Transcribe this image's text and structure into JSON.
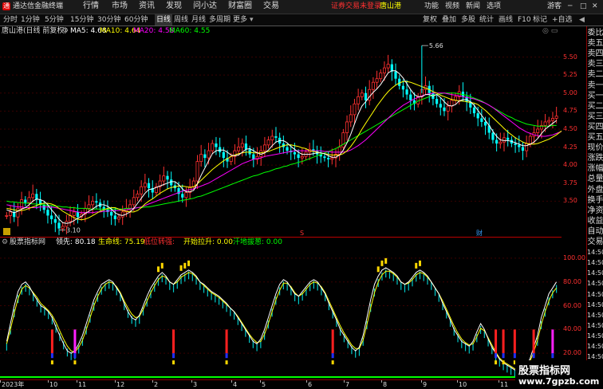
{
  "titlebar": {
    "app_name": "通达信金融终端",
    "menus": [
      "行情",
      "市场",
      "资讯",
      "发现",
      "问小达",
      "财富圈",
      "交易"
    ],
    "login_notice": "证券交易未登录",
    "stock_name": "唐山港",
    "right_menus": [
      "功能",
      "视频",
      "新闻",
      "选项"
    ],
    "guest": "游客",
    "window_controls": [
      "─",
      "□",
      "✕"
    ]
  },
  "periods": {
    "items": [
      "分时",
      "1分钟",
      "5分钟",
      "15分钟",
      "30分钟",
      "60分钟",
      "日线",
      "周线",
      "月线",
      "多周期",
      "更多"
    ],
    "active": "日线"
  },
  "tools": {
    "items": [
      "复权",
      "叠加",
      "多股",
      "统计",
      "画线",
      "F10",
      "标记",
      "+自选",
      "◀"
    ]
  },
  "infobar": {
    "title": "唐山港(日线 前复权)",
    "ma5": "MA5: 4.68",
    "ma10": "MA10: 4.64",
    "ma20": "MA20: 4.58",
    "ma60": "MA60: 4.55"
  },
  "indicator": {
    "name": "股票指标网",
    "lead": "领先: 80.18",
    "life": "生命线: 75.19",
    "low_gold": "低位转强:",
    "open_rise": "开始拉升: 0.00",
    "pullback": "汗地拔葱: 0.00"
  },
  "colors": {
    "ma5": "#ffffff",
    "ma10": "#ffff00",
    "ma20": "#ff00ff",
    "ma60": "#00ff00",
    "up": "#ff3030",
    "down": "#00ffff",
    "lead": "#ffffff",
    "life": "#ffff00"
  },
  "chart_data": [
    {
      "type": "candlestick",
      "title": "唐山港(日线 前复权)",
      "y_ticks": [
        "5.50",
        "5.25",
        "5.00",
        "4.75",
        "4.50",
        "4.25",
        "4.00",
        "3.75",
        "3.50"
      ],
      "ylim": [
        3.05,
        5.75
      ],
      "annotations": {
        "max": "5.66",
        "min": "3.10"
      },
      "markers": [
        "S",
        "财"
      ],
      "close": [
        3.3,
        3.35,
        3.28,
        3.4,
        3.52,
        3.48,
        3.55,
        3.6,
        3.52,
        3.45,
        3.38,
        3.3,
        3.25,
        3.2,
        3.12,
        3.15,
        3.22,
        3.3,
        3.35,
        3.28,
        3.32,
        3.4,
        3.45,
        3.5,
        3.48,
        3.42,
        3.38,
        3.35,
        3.3,
        3.25,
        3.28,
        3.35,
        3.4,
        3.45,
        3.55,
        3.6,
        3.7,
        3.75,
        3.68,
        3.62,
        3.7,
        3.78,
        3.85,
        3.8,
        3.72,
        3.68,
        3.6,
        3.55,
        3.62,
        3.7,
        3.78,
        4.05,
        4.15,
        4.1,
        4.2,
        4.3,
        4.25,
        4.18,
        4.1,
        4.05,
        4.12,
        4.2,
        4.25,
        4.3,
        4.22,
        4.15,
        4.08,
        4.12,
        4.2,
        4.28,
        4.35,
        4.4,
        4.38,
        4.3,
        4.25,
        4.2,
        4.18,
        4.15,
        4.1,
        4.12,
        4.18,
        4.22,
        4.2,
        4.15,
        4.12,
        4.1,
        4.08,
        4.1,
        4.15,
        4.25,
        4.45,
        4.6,
        4.7,
        4.85,
        4.95,
        5.0,
        4.9,
        5.05,
        5.15,
        5.2,
        5.28,
        5.35,
        5.4,
        5.3,
        5.2,
        5.1,
        5.05,
        4.98,
        4.9,
        4.85,
        4.95,
        5.05,
        5.1,
        5.0,
        4.92,
        4.85,
        4.8,
        4.75,
        4.82,
        4.9,
        4.95,
        5.02,
        4.95,
        4.88,
        4.8,
        4.72,
        4.65,
        4.6,
        4.55,
        4.45,
        4.35,
        4.3,
        4.32,
        4.38,
        4.35,
        4.3,
        4.28,
        4.25,
        4.2,
        4.3,
        4.4,
        4.45,
        4.5,
        4.55,
        4.6,
        4.62,
        4.65,
        4.68
      ],
      "ma5": [
        3.38,
        3.36,
        3.34,
        3.36,
        3.39,
        3.41,
        3.45,
        3.5,
        3.53,
        3.52,
        3.5,
        3.45,
        3.38,
        3.32,
        3.25,
        3.2,
        3.19,
        3.2,
        3.23,
        3.26,
        3.29,
        3.33,
        3.36,
        3.39,
        3.43,
        3.45,
        3.45,
        3.43,
        3.39,
        3.34,
        3.31,
        3.3,
        3.32,
        3.35,
        3.4,
        3.47,
        3.54,
        3.61,
        3.66,
        3.67,
        3.69,
        3.71,
        3.73,
        3.75,
        3.77,
        3.77,
        3.73,
        3.67,
        3.63,
        3.63,
        3.65,
        3.74,
        3.86,
        3.96,
        4.06,
        4.16,
        4.2,
        4.21,
        4.21,
        4.18,
        4.14,
        4.13,
        4.14,
        4.18,
        4.22,
        4.23,
        4.2,
        4.17,
        4.15,
        4.17,
        4.21,
        4.27,
        4.32,
        4.34,
        4.34,
        4.31,
        4.26,
        4.22,
        4.18,
        4.15,
        4.15,
        4.15,
        4.16,
        4.17,
        4.17,
        4.16,
        4.13,
        4.11,
        4.11,
        4.14,
        4.21,
        4.31,
        4.43,
        4.57,
        4.71,
        4.82,
        4.88,
        4.95,
        5.01,
        5.06,
        5.12,
        5.2,
        5.28,
        5.31,
        5.31,
        5.27,
        5.21,
        5.13,
        5.05,
        4.98,
        4.95,
        4.95,
        4.98,
        4.98,
        4.96,
        4.98,
        4.94,
        4.88,
        4.83,
        4.82,
        4.84,
        4.89,
        4.91,
        4.91,
        4.88,
        4.83,
        4.76,
        4.69,
        4.62,
        4.55,
        4.47,
        4.4,
        4.35,
        4.34,
        4.34,
        4.33,
        4.31,
        4.29,
        4.27,
        4.27,
        4.29,
        4.32,
        4.37,
        4.44,
        4.5,
        4.54,
        4.58,
        4.62
      ],
      "ma10": [
        3.4,
        3.39,
        3.38,
        3.37,
        3.37,
        3.38,
        3.4,
        3.42,
        3.44,
        3.46,
        3.47,
        3.47,
        3.46,
        3.44,
        3.4,
        3.36,
        3.33,
        3.3,
        3.27,
        3.25,
        3.24,
        3.25,
        3.27,
        3.3,
        3.33,
        3.36,
        3.38,
        3.4,
        3.41,
        3.41,
        3.39,
        3.37,
        3.36,
        3.35,
        3.35,
        3.37,
        3.41,
        3.46,
        3.5,
        3.53,
        3.57,
        3.61,
        3.64,
        3.67,
        3.69,
        3.7,
        3.71,
        3.71,
        3.7,
        3.69,
        3.7,
        3.74,
        3.79,
        3.84,
        3.89,
        3.94,
        3.98,
        4.02,
        4.06,
        4.09,
        4.12,
        4.14,
        4.16,
        4.17,
        4.18,
        4.18,
        4.17,
        4.17,
        4.17,
        4.18,
        4.19,
        4.21,
        4.23,
        4.25,
        4.27,
        4.28,
        4.28,
        4.27,
        4.26,
        4.24,
        4.23,
        4.2,
        4.19,
        4.18,
        4.17,
        4.16,
        4.15,
        4.14,
        4.14,
        4.14,
        4.16,
        4.2,
        4.26,
        4.33,
        4.41,
        4.5,
        4.58,
        4.66,
        4.74,
        4.82,
        4.89,
        4.96,
        5.02,
        5.07,
        5.11,
        5.14,
        5.16,
        5.16,
        5.15,
        5.13,
        5.11,
        5.09,
        5.07,
        5.05,
        5.02,
        5.0,
        4.97,
        4.95,
        4.93,
        4.91,
        4.9,
        4.89,
        4.89,
        4.88,
        4.87,
        4.86,
        4.84,
        4.8,
        4.76,
        4.71,
        4.66,
        4.61,
        4.56,
        4.51,
        4.46,
        4.42,
        4.38,
        4.35,
        4.32,
        4.3,
        4.29,
        4.29,
        4.3,
        4.32,
        4.34,
        4.36,
        4.39,
        4.42,
        4.46,
        4.5
      ],
      "ma20": [
        3.45,
        3.44,
        3.43,
        3.42,
        3.42,
        3.41,
        3.41,
        3.41,
        3.41,
        3.42,
        3.42,
        3.42,
        3.42,
        3.41,
        3.4,
        3.39,
        3.38,
        3.37,
        3.36,
        3.35,
        3.34,
        3.34,
        3.34,
        3.34,
        3.35,
        3.35,
        3.36,
        3.36,
        3.37,
        3.37,
        3.37,
        3.38,
        3.38,
        3.39,
        3.4,
        3.41,
        3.42,
        3.44,
        3.46,
        3.48,
        3.5,
        3.52,
        3.54,
        3.56,
        3.58,
        3.6,
        3.62,
        3.64,
        3.65,
        3.66,
        3.67,
        3.69,
        3.71,
        3.73,
        3.75,
        3.78,
        3.81,
        3.84,
        3.87,
        3.9,
        3.93,
        3.96,
        3.99,
        4.02,
        4.04,
        4.06,
        4.08,
        4.09,
        4.1,
        4.12,
        4.13,
        4.14,
        4.15,
        4.16,
        4.17,
        4.18,
        4.19,
        4.2,
        4.2,
        4.2,
        4.2,
        4.2,
        4.2,
        4.2,
        4.2,
        4.19,
        4.19,
        4.18,
        4.18,
        4.18,
        4.18,
        4.19,
        4.21,
        4.24,
        4.27,
        4.31,
        4.35,
        4.4,
        4.45,
        4.5,
        4.55,
        4.6,
        4.65,
        4.7,
        4.75,
        4.79,
        4.83,
        4.86,
        4.89,
        4.92,
        4.94,
        4.96,
        4.98,
        4.99,
        5.0,
        5.0,
        5.0,
        5.0,
        4.99,
        4.98,
        4.97,
        4.96,
        4.95,
        4.94,
        4.93,
        4.92,
        4.9,
        4.88,
        4.86,
        4.83,
        4.8,
        4.76,
        4.72,
        4.68,
        4.64,
        4.6,
        4.56,
        4.52,
        4.49,
        4.46,
        4.44,
        4.42,
        4.41,
        4.4,
        4.4,
        4.41,
        4.42,
        4.44,
        4.46,
        4.48
      ],
      "ma60": [
        3.5,
        3.49,
        3.49,
        3.48,
        3.48,
        3.47,
        3.47,
        3.46,
        3.46,
        3.45,
        3.45,
        3.44,
        3.44,
        3.43,
        3.43,
        3.42,
        3.42,
        3.41,
        3.41,
        3.4,
        3.4,
        3.4,
        3.39,
        3.39,
        3.39,
        3.39,
        3.39,
        3.39,
        3.39,
        3.39,
        3.39,
        3.39,
        3.4,
        3.4,
        3.4,
        3.41,
        3.41,
        3.42,
        3.42,
        3.43,
        3.44,
        3.45,
        3.46,
        3.47,
        3.48,
        3.49,
        3.5,
        3.51,
        3.52,
        3.53,
        3.54,
        3.56,
        3.57,
        3.59,
        3.61,
        3.63,
        3.65,
        3.67,
        3.69,
        3.71,
        3.73,
        3.75,
        3.77,
        3.79,
        3.81,
        3.83,
        3.85,
        3.86,
        3.88,
        3.9,
        3.91,
        3.93,
        3.95,
        3.96,
        3.98,
        3.99,
        4.01,
        4.02,
        4.04,
        4.05,
        4.07,
        4.09,
        4.11,
        4.13,
        4.15,
        4.17,
        4.19,
        4.21,
        4.23,
        4.26,
        4.29,
        4.32,
        4.35,
        4.38,
        4.41,
        4.44,
        4.47,
        4.5,
        4.53,
        4.56,
        4.59,
        4.62,
        4.65,
        4.68,
        4.71,
        4.74,
        4.77,
        4.8,
        4.83,
        4.86,
        4.89,
        4.91,
        4.93,
        4.95,
        4.97,
        4.98,
        4.99,
        5.0,
        5.0,
        5.0,
        5.0,
        4.99,
        4.98,
        4.97,
        4.95,
        4.93,
        4.91,
        4.89,
        4.86,
        4.83,
        4.8,
        4.77,
        4.74,
        4.71,
        4.68,
        4.66,
        4.63,
        4.61,
        4.59,
        4.57,
        4.56,
        4.55,
        4.54,
        4.54,
        4.54,
        4.54,
        4.55,
        4.55
      ]
    },
    {
      "type": "line",
      "title": "股票指标网",
      "y_ticks": [
        "100.00",
        "80.00",
        "60.00",
        "40.00",
        "20.00"
      ],
      "ylim": [
        0,
        108
      ],
      "series": [
        {
          "name": "领先",
          "values": [
            30,
            45,
            60,
            72,
            78,
            80,
            76,
            70,
            65,
            60,
            58,
            55,
            50,
            42,
            35,
            28,
            22,
            20,
            22,
            28,
            35,
            45,
            55,
            65,
            72,
            78,
            80,
            82,
            80,
            75,
            70,
            62,
            55,
            50,
            48,
            52,
            60,
            68,
            75,
            80,
            85,
            88,
            85,
            80,
            78,
            82,
            86,
            88,
            90,
            88,
            85,
            80,
            78,
            75,
            72,
            70,
            68,
            65,
            62,
            58,
            55,
            50,
            45,
            40,
            35,
            30,
            28,
            32,
            40,
            50,
            60,
            70,
            78,
            82,
            80,
            75,
            70,
            68,
            72,
            76,
            80,
            82,
            80,
            75,
            70,
            62,
            55,
            48,
            40,
            35,
            30,
            25,
            22,
            25,
            35,
            50,
            65,
            78,
            85,
            90,
            92,
            90,
            88,
            85,
            80,
            78,
            80,
            84,
            88,
            90,
            88,
            85,
            80,
            75,
            70,
            62,
            55,
            48,
            40,
            35,
            30,
            28,
            26,
            30,
            38,
            45,
            40,
            32,
            25,
            20,
            15,
            12,
            10,
            8,
            6,
            5,
            8,
            10,
            15,
            25,
            35,
            50,
            60,
            70,
            75,
            80
          ]
        },
        {
          "name": "生命线",
          "values": [
            28,
            40,
            54,
            66,
            74,
            77,
            75,
            71,
            67,
            62,
            59,
            56,
            52,
            46,
            39,
            32,
            26,
            22,
            21,
            25,
            31,
            40,
            50,
            60,
            68,
            74,
            78,
            80,
            79,
            76,
            71,
            64,
            58,
            53,
            50,
            51,
            57,
            64,
            71,
            77,
            82,
            85,
            84,
            80,
            78,
            80,
            84,
            86,
            88,
            87,
            84,
            80,
            77,
            74,
            71,
            69,
            67,
            64,
            61,
            58,
            55,
            51,
            46,
            41,
            36,
            32,
            29,
            30,
            36,
            45,
            55,
            65,
            73,
            79,
            79,
            76,
            71,
            68,
            70,
            74,
            78,
            80,
            79,
            76,
            71,
            64,
            57,
            50,
            43,
            37,
            32,
            27,
            24,
            24,
            31,
            44,
            58,
            71,
            80,
            86,
            89,
            89,
            87,
            84,
            80,
            78,
            79,
            82,
            86,
            88,
            87,
            84,
            80,
            75,
            70,
            64,
            57,
            50,
            43,
            37,
            32,
            29,
            27,
            28,
            34,
            41,
            39,
            33,
            27,
            21,
            16,
            13,
            11,
            9,
            7,
            6,
            7,
            9,
            13,
            21,
            31,
            44,
            55,
            64,
            71,
            75
          ]
        }
      ],
      "signal_legend": [
        "低位转强",
        "开始拉升",
        "汗地拔葱"
      ]
    }
  ],
  "yaxis_price": [
    "5.50",
    "5.25",
    "5.00",
    "4.75",
    "4.50",
    "4.25",
    "4.00",
    "3.75",
    "3.50"
  ],
  "yaxis_ind": [
    "100.00",
    "80.00",
    "60.00",
    "40.00",
    "20.00"
  ],
  "xaxis": {
    "labels": [
      "2023年",
      "10",
      "11",
      "12",
      "2",
      "3",
      "4",
      "5",
      "6",
      "7",
      "8",
      "9",
      "10",
      "11",
      "12"
    ]
  },
  "sidepanel": {
    "items": [
      "委比",
      "卖五",
      "卖四",
      "卖三",
      "卖二",
      "卖一",
      "买一",
      "买二",
      "买三",
      "买四",
      "买五",
      "现价",
      "涨跌",
      "涨幅",
      "总量",
      "外盘",
      "换手",
      "净资",
      "收益",
      "自动",
      "交易",
      "14:50",
      "14:50",
      "14:50",
      "14:50",
      "14:50",
      "14:50",
      "14:50",
      "14:50",
      "14:50",
      "14:50",
      "14:50"
    ]
  },
  "watermark": {
    "line1": "股票指标网",
    "line2": "www.7gpzb.com"
  }
}
